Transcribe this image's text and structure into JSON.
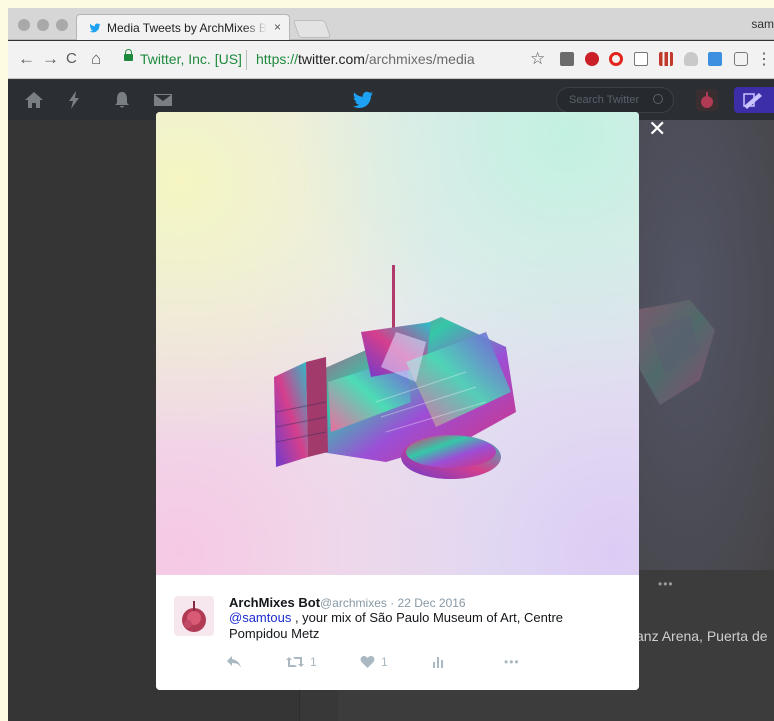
{
  "browser": {
    "tab": {
      "title": "Media Tweets by ArchMixes Bc",
      "close": "×"
    },
    "profile_label": "sam",
    "nav": {
      "back": "←",
      "forward": "→",
      "reload": "C",
      "home": "⌂"
    },
    "address": {
      "secure_label": "Twitter, Inc. [US]",
      "url_scheme": "https://",
      "url_host": "twitter.com",
      "url_path": "/archmixes/media"
    },
    "star": "☆",
    "menu": "⋮",
    "extensions": [
      "text-extension-icon",
      "pinterest-icon",
      "opera-icon",
      "page-icon",
      "bars-extension-icon",
      "cloud-icon",
      "pen-extension-icon",
      "camera-icon"
    ]
  },
  "twitter_nav": {
    "search_placeholder": "Search Twitter",
    "icons": [
      "home-icon",
      "moments-icon",
      "notifications-icon",
      "messages-icon",
      "twitter-logo-icon"
    ]
  },
  "background": {
    "more": "•••",
    "text": "anz Arena, Puerta de"
  },
  "modal": {
    "close": "✕",
    "tweet": {
      "name": "ArchMixes Bot",
      "handle": "@archmixes",
      "date_sep": " · ",
      "date": "22 Dec 2016",
      "mention": "@samtous",
      "text": " , your mix of São Paulo Museum of Art, Centre Pompidou Metz",
      "retweets": "1",
      "likes": "1",
      "more": "•••"
    }
  },
  "colors": {
    "accent_link": "#1b2ccf",
    "secure_green": "#1e8a3e",
    "compose_purple": "#3b2ea6"
  }
}
